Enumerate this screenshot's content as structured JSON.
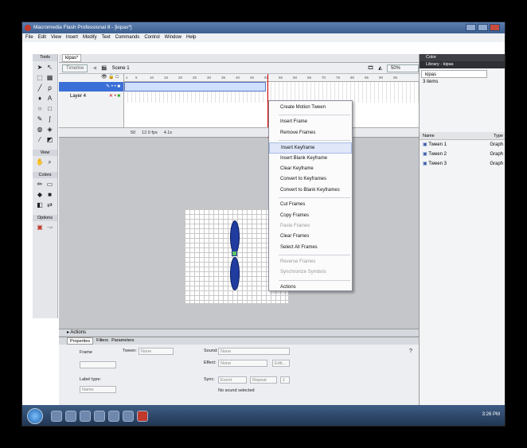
{
  "window": {
    "title": "Macromedia Flash Professional 8 - [kipas*]"
  },
  "menubar": [
    "File",
    "Edit",
    "View",
    "Insert",
    "Modify",
    "Text",
    "Commands",
    "Control",
    "Window",
    "Help"
  ],
  "tools": {
    "header": "Tools",
    "view_label": "View",
    "colors_label": "Colors",
    "options_label": "Options"
  },
  "document": {
    "tab": "kipas*",
    "timeline_btn": "Timeline",
    "scene": "Scene 1",
    "zoom": "50%",
    "ruler": [
      "1",
      "5",
      "10",
      "15",
      "20",
      "25",
      "30",
      "35",
      "40",
      "45",
      "50",
      "55",
      "60",
      "65",
      "70",
      "75",
      "80",
      "85",
      "90",
      "95"
    ],
    "layers": [
      {
        "name": ""
      },
      {
        "name": "Layer 4"
      }
    ],
    "status": {
      "frame": "50",
      "fps": "12.0 fps",
      "time": "4.1s"
    }
  },
  "context_menu": [
    {
      "label": "Create Motion Tween",
      "disabled": false
    },
    {
      "sep": true
    },
    {
      "label": "Insert Frame",
      "disabled": false
    },
    {
      "label": "Remove Frames",
      "disabled": false
    },
    {
      "sep": true
    },
    {
      "label": "Insert Keyframe",
      "disabled": false,
      "highlight": true
    },
    {
      "label": "Insert Blank Keyframe",
      "disabled": false
    },
    {
      "label": "Clear Keyframe",
      "disabled": false
    },
    {
      "label": "Convert to Keyframes",
      "disabled": false
    },
    {
      "label": "Convert to Blank Keyframes",
      "disabled": false
    },
    {
      "sep": true
    },
    {
      "label": "Cut Frames",
      "disabled": false
    },
    {
      "label": "Copy Frames",
      "disabled": false
    },
    {
      "label": "Paste Frames",
      "disabled": true
    },
    {
      "label": "Clear Frames",
      "disabled": false
    },
    {
      "label": "Select All Frames",
      "disabled": false
    },
    {
      "sep": true
    },
    {
      "label": "Reverse Frames",
      "disabled": true
    },
    {
      "label": "Synchronize Symbols",
      "disabled": true
    },
    {
      "sep": true
    },
    {
      "label": "Actions",
      "disabled": false
    }
  ],
  "actions_panel": {
    "label": "Actions"
  },
  "properties": {
    "tabs": [
      "Properties",
      "Filters",
      "Parameters"
    ],
    "frame_label": "Frame",
    "tween_label": "Tween:",
    "tween_value": "None",
    "sound_label": "Sound:",
    "sound_value": "None",
    "effect_label": "Effect:",
    "effect_value": "None",
    "edit_btn": "Edit...",
    "sync_label": "Sync:",
    "sync_value": "Event",
    "repeat_value": "Repeat",
    "repeat_count": "1",
    "label_type_label": "Label type:",
    "label_type_value": "Name",
    "no_sound": "No sound selected"
  },
  "right_panel": {
    "color_header": "Color",
    "library_header": "Library - kipas",
    "library_select": "kipas",
    "item_count": "3 items",
    "col_name": "Name",
    "col_type": "Type",
    "items": [
      {
        "name": "Tween 1",
        "type": "Graph"
      },
      {
        "name": "Tween 2",
        "type": "Graph"
      },
      {
        "name": "Tween 3",
        "type": "Graph"
      }
    ]
  },
  "taskbar": {
    "clock": "3:26 PM"
  }
}
